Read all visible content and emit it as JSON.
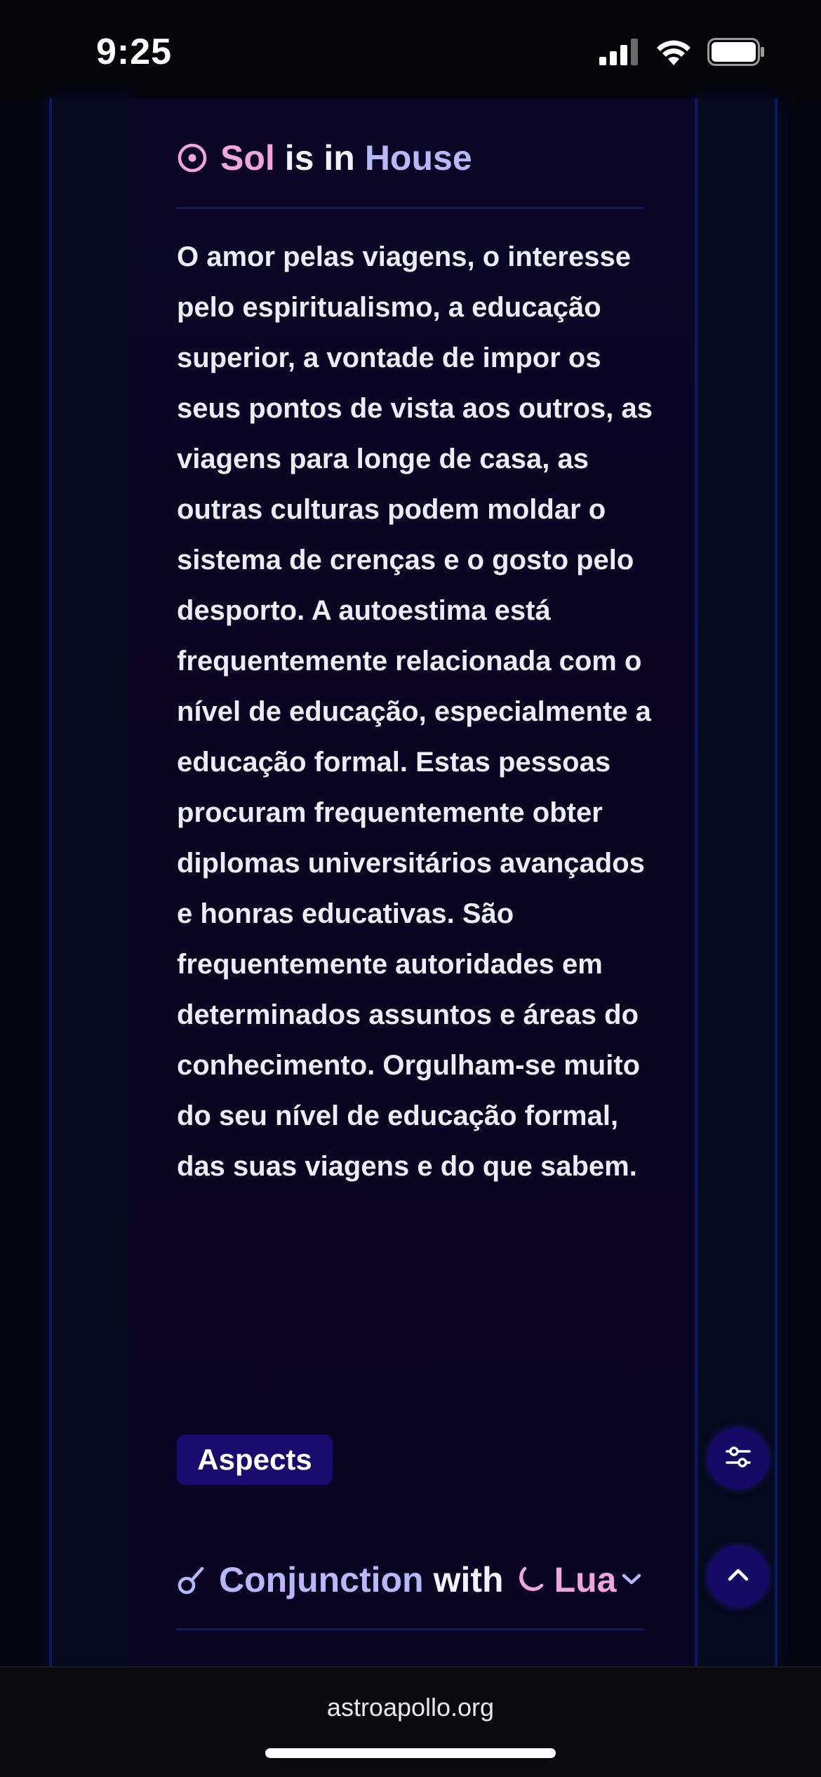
{
  "status_bar": {
    "time": "9:25"
  },
  "heading": {
    "planet": "Sol",
    "connector": "is in",
    "place": "House",
    "icon": "sun-symbol-icon"
  },
  "description": "O amor pelas viagens, o interesse pelo espiritualismo, a educação superior, a vontade de impor os seus pontos de vista aos outros, as viagens para longe de casa, as outras culturas podem moldar o sistema de crenças e o gosto pelo desporto. A autoestima está frequentemente relacionada com o nível de educação, especialmente a educação formal. Estas pessoas procuram frequentemente obter diplomas universitários avançados e honras educativas. São frequentemente autoridades em determinados assuntos e áreas do conhecimento. Orgulham-se muito do seu nível de educação formal, das suas viagens e do que sabem.",
  "aspects": {
    "badge_label": "Aspects",
    "first_aspect": {
      "type": "Conjunction",
      "connector": "with",
      "planet": "Lua",
      "icon": "conjunction-icon",
      "planet_icon": "moon-icon"
    }
  },
  "fabs": {
    "settings_icon": "sliders-icon",
    "scroll_top_icon": "chevron-up-icon"
  },
  "browser": {
    "url": "astroapollo.org"
  },
  "colors": {
    "background": "#05050d",
    "panel": "#0b0626",
    "pink_accent": "#f0a6dc",
    "lavender_accent": "#b8b8f8",
    "badge": "#1a0c6e"
  }
}
